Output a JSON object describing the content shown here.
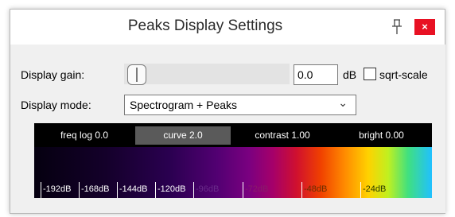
{
  "window": {
    "title": "Peaks Display Settings",
    "close_glyph": "×"
  },
  "gain": {
    "label": "Display gain:",
    "value": "0.0",
    "unit": "dB",
    "sqrt_label": "sqrt-scale",
    "sqrt_checked": false
  },
  "mode": {
    "label": "Display mode:",
    "selected": "Spectrogram + Peaks",
    "chevron": "⌄"
  },
  "param_buttons": [
    {
      "label": "freq log 0.0",
      "active": false
    },
    {
      "label": "curve 2.0",
      "active": true
    },
    {
      "label": "contrast 1.00",
      "active": false
    },
    {
      "label": "bright 0.00",
      "active": false
    }
  ],
  "spectrum_scale": [
    "-192dB",
    "-168dB",
    "-144dB",
    "-120dB",
    "-96dB",
    "-72dB",
    "-48dB",
    "-24dB"
  ],
  "colors": {
    "close_bg": "#e81123",
    "active_button": "#5a5a5a",
    "bar_bg": "#000000"
  },
  "icons": {
    "pin": "pin-icon",
    "close": "close-icon",
    "dropdown": "chevron-down-icon"
  }
}
